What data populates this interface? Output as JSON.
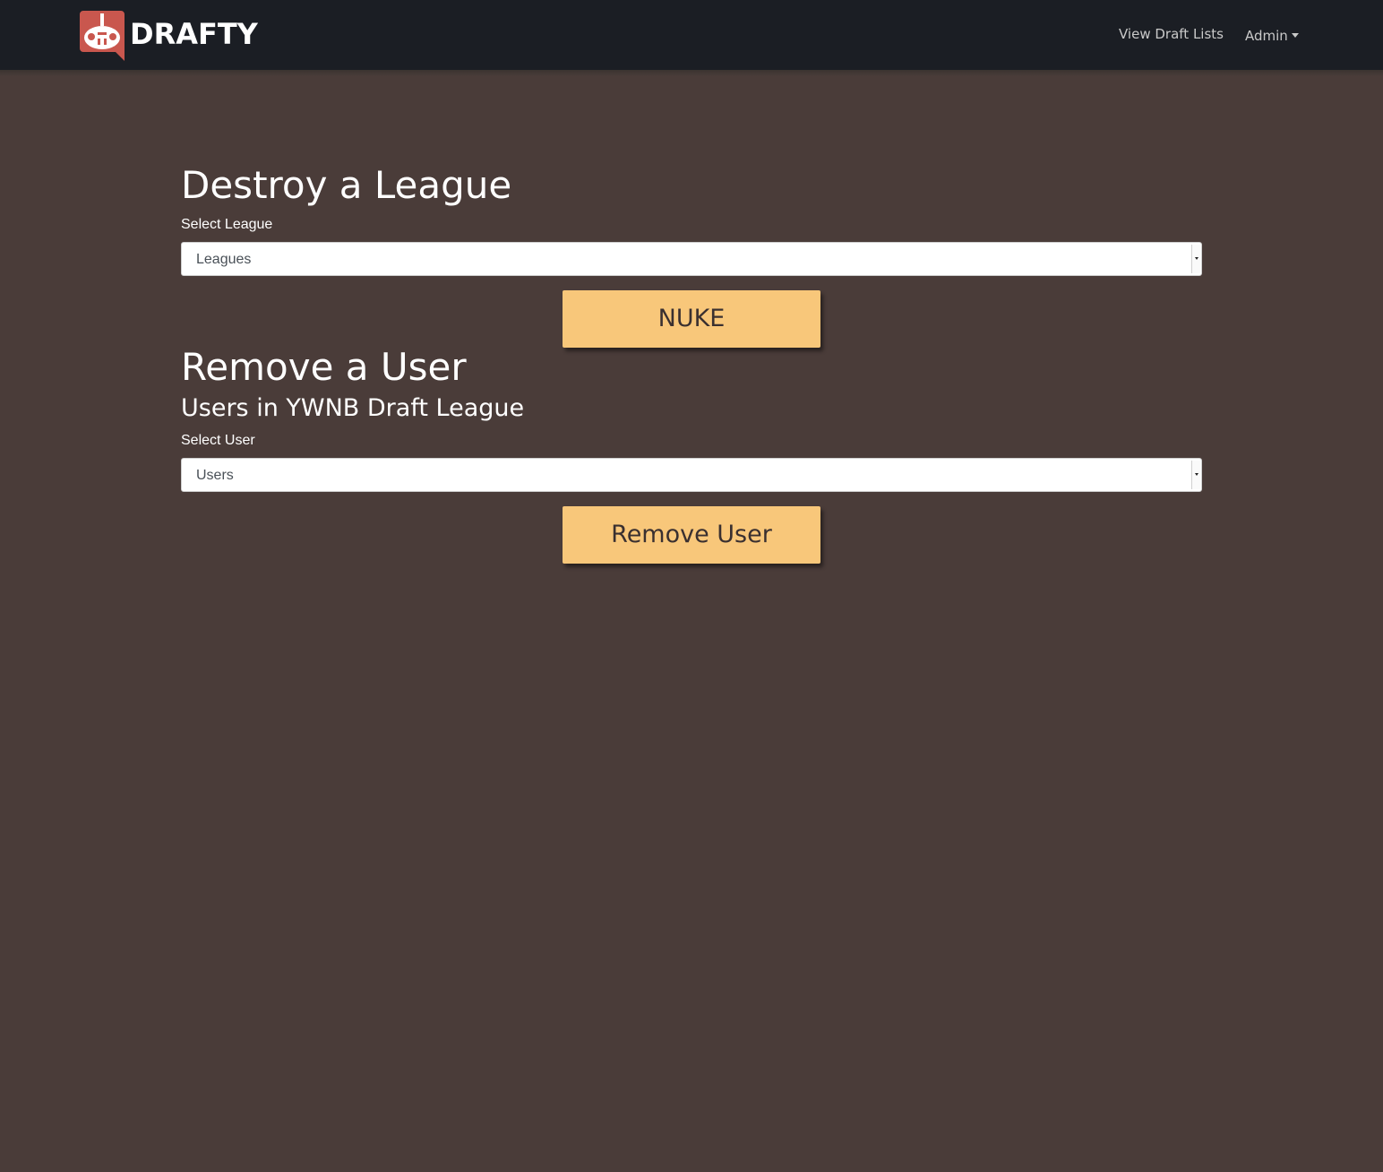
{
  "navbar": {
    "brand": "DRAFTY",
    "links": {
      "view_draft_lists": "View Draft Lists",
      "admin": "Admin"
    },
    "colors": {
      "background": "#1b1e24",
      "logo": "#c9574e"
    }
  },
  "destroy_league": {
    "title": "Destroy a League",
    "select_label": "Select League",
    "select_value": "Leagues",
    "button_label": "NUKE"
  },
  "remove_user": {
    "title": "Remove a User",
    "subtitle": "Users in YWNB Draft League",
    "select_label": "Select User",
    "select_value": "Users",
    "button_label": "Remove User"
  },
  "colors": {
    "page_background": "#4a3c39",
    "button": "#f8c77a"
  },
  "icons": {
    "logo": "drafty-logo-icon",
    "admin_dropdown": "caret-down-icon",
    "select_arrow": "chevron-down-icon"
  }
}
